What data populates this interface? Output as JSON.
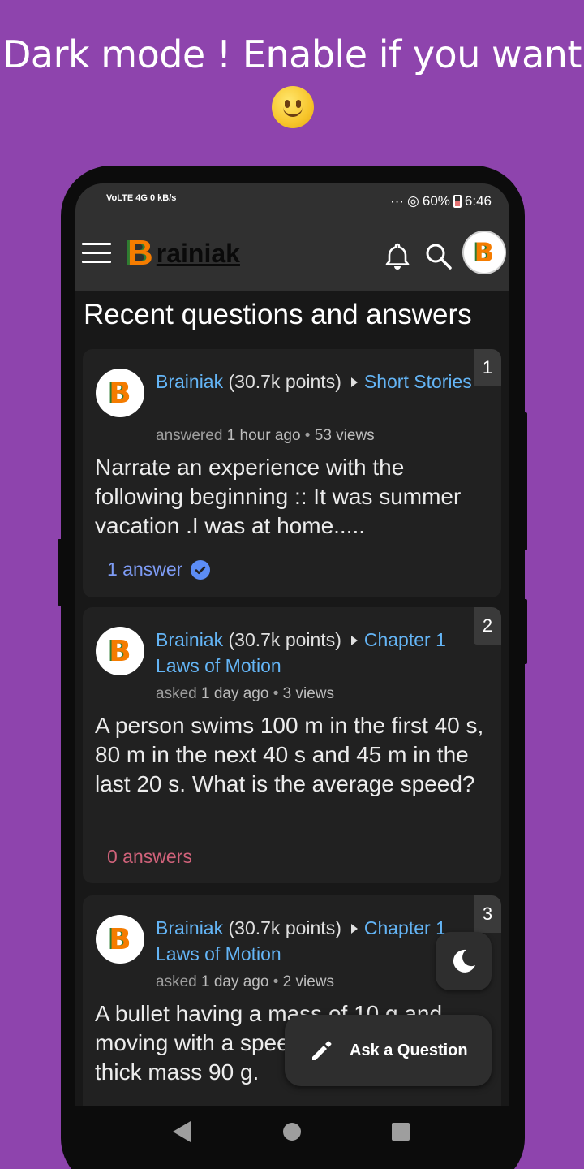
{
  "promo": {
    "title": "Dark mode ! Enable if you want",
    "emoji": "slightly-smiling-face"
  },
  "status_bar": {
    "left": "VoLTE 4G 0 kB/s",
    "battery": "60%",
    "time": "6:46"
  },
  "app_bar": {
    "logo_letter": "B",
    "logo_text": "rainiak",
    "avatar_letter": "B"
  },
  "section_title": "Recent questions and answers",
  "cards": [
    {
      "rank": "1",
      "user": "Brainiak",
      "points": "(30.7k points)",
      "category": "Short Stories",
      "action": "answered",
      "when": "1 hour ago",
      "views": "53 views",
      "question": "Narrate an experience with the following beginning :: It was summer vacation .I was at home.....",
      "answers": "1 answer",
      "answers_color": "#7e9cf5",
      "accepted": true
    },
    {
      "rank": "2",
      "user": "Brainiak",
      "points": "(30.7k points)",
      "category": "Chapter 1 Laws of Motion",
      "action": "asked",
      "when": "1 day ago",
      "views": "3 views",
      "question": "A person swims 100 m in the first 40 s, 80 m in the next 40 s and 45 m in the last 20 s. What is the average speed?",
      "answers": "0 answers",
      "answers_color": "#d0627a",
      "accepted": false
    },
    {
      "rank": "3",
      "user": "Brainiak",
      "points": "(30.7k points)",
      "category": "Chapter 1 Laws of Motion",
      "action": "asked",
      "when": "1 day ago",
      "views": "2 views",
      "question": "A bullet having a mass of 10 g and moving with a speed of penetrates a thick mass 90 g."
    }
  ],
  "fab": {
    "label": "Ask a Question"
  },
  "colors": {
    "background": "#8e44ad",
    "surface": "#212121",
    "appbar": "#303030",
    "link": "#64b5f6"
  }
}
